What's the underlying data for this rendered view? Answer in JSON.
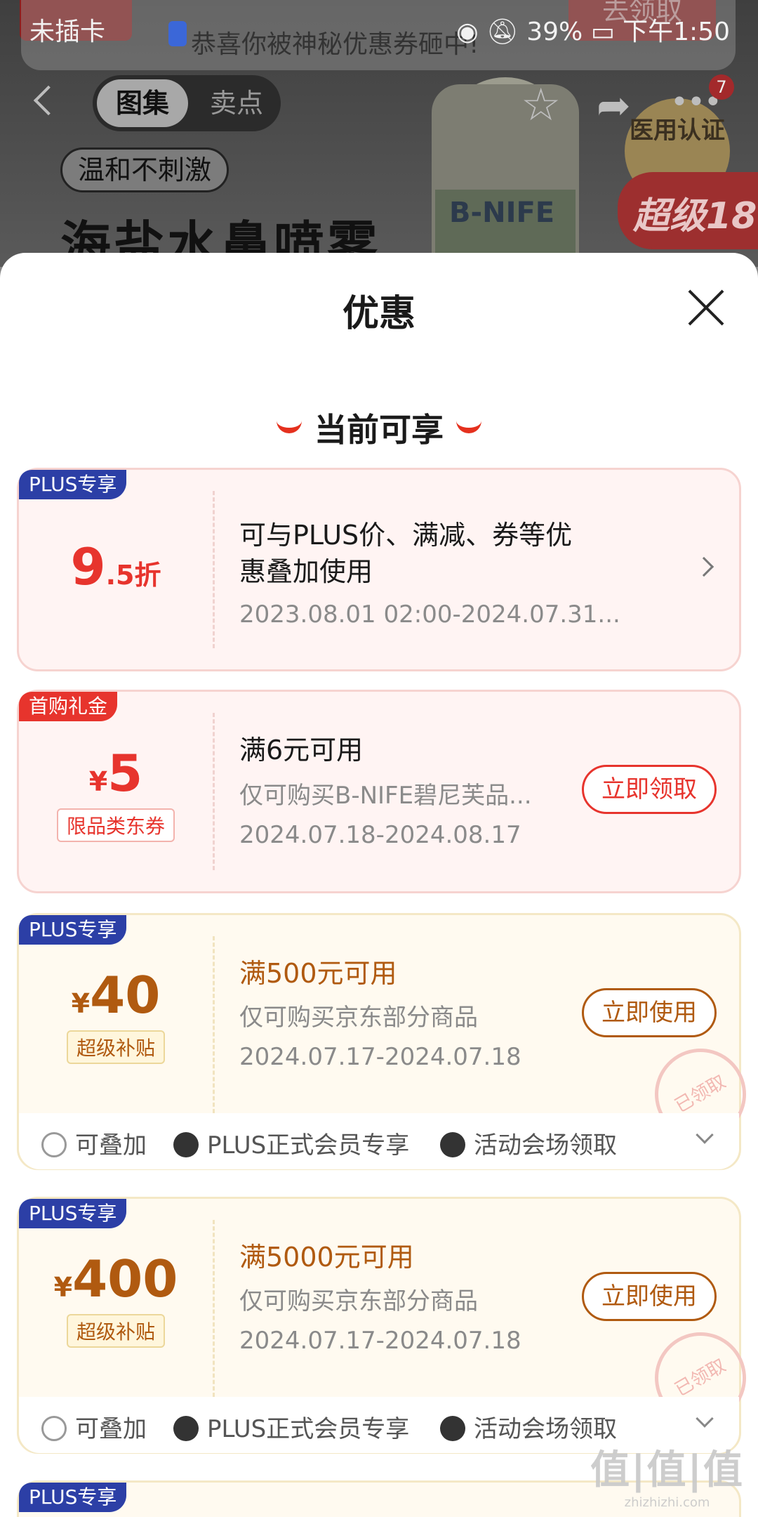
{
  "status_bar": {
    "left": "未插卡",
    "battery": "39%",
    "time": "下午1:50"
  },
  "notification": {
    "text": "恭喜你被神秘优惠券砸中!",
    "top_right_button": "去领取"
  },
  "background": {
    "segment_tabs": [
      "图集",
      "卖点"
    ],
    "more_badge": "7",
    "tag": "温和不刺激",
    "title": "海盐水鼻喷雾",
    "product_label": "B-NIFE",
    "medal": "医用认证",
    "promo": "超级18"
  },
  "sheet": {
    "title": "优惠",
    "section_title": "当前可享"
  },
  "coupons": [
    {
      "tag": "PLUS专享",
      "amount_main": "9",
      "amount_rest": ".5折",
      "title": "可与PLUS价、满减、券等优惠叠加使用",
      "title_line1": "可与PLUS价、满减、券等优",
      "title_line2": "惠叠加使用",
      "date": "2023.08.01 02:00-2024.07.31..."
    },
    {
      "tag": "首购礼金",
      "currency": "¥",
      "amount": "5",
      "subtag": "限品类东券",
      "title": "满6元可用",
      "desc": "仅可购买B-NIFE碧尼芙品...",
      "date": "2024.07.18-2024.08.17",
      "button": "立即领取"
    },
    {
      "tag": "PLUS专享",
      "currency": "¥",
      "amount": "40",
      "subtag": "超级补贴",
      "title": "满500元可用",
      "desc": "仅可购买京东部分商品",
      "date": "2024.07.17-2024.07.18",
      "button": "立即使用",
      "stamp": "已领取",
      "footer": [
        "可叠加",
        "PLUS正式会员专享",
        "活动会场领取"
      ]
    },
    {
      "tag": "PLUS专享",
      "currency": "¥",
      "amount": "400",
      "subtag": "超级补贴",
      "title": "满5000元可用",
      "desc": "仅可购买京东部分商品",
      "date": "2024.07.17-2024.07.18",
      "button": "立即使用",
      "stamp": "已领取",
      "footer": [
        "可叠加",
        "PLUS正式会员专享",
        "活动会场领取"
      ]
    },
    {
      "tag": "PLUS专享"
    }
  ],
  "watermark": {
    "main": "值|值|值",
    "sub": "zhizhizhi.com"
  },
  "colors": {
    "accent_red": "#e7342d",
    "plus_blue": "#2c3fa6",
    "gold_text": "#b05a10"
  }
}
